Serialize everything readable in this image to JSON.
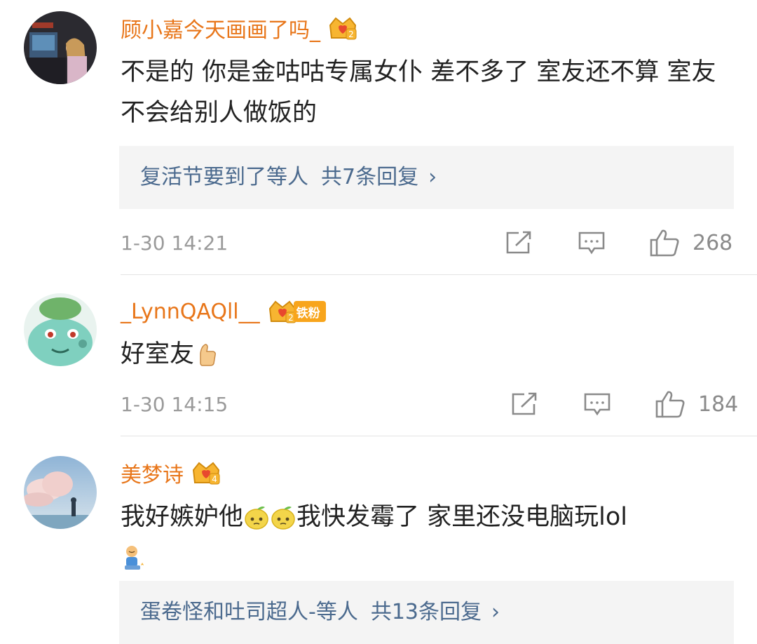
{
  "comments": [
    {
      "username": "顾小嘉今天画画了吗_",
      "badge_level": "2",
      "text": "不是的 你是金咕咕专属女仆 差不多了 室友还不算 室友不会给别人做饭的",
      "reply_preview": "复活节要到了等人",
      "reply_count": "共7条回复",
      "time": "1-30 14:21",
      "likes": "268"
    },
    {
      "username": "_LynnQAQll__",
      "badge_level": "2",
      "fan_tag": "铁粉",
      "text": "好室友",
      "time": "1-30 14:15",
      "likes": "184"
    },
    {
      "username": "美梦诗",
      "badge_level": "4",
      "text_part1": "我好嫉妒他",
      "text_part2": "我快发霉了 家里还没电脑玩lol",
      "reply_preview": "蛋卷怪和吐司超人-等人",
      "reply_count": "共13条回复"
    }
  ],
  "icons": {
    "share": "share-icon",
    "comment": "comment-icon",
    "like": "thumbs-up-icon",
    "chevron": "chevron-right-icon"
  },
  "colors": {
    "username": "#e8761a",
    "reply_link": "#4b6a8e",
    "meta": "#9a9a9a",
    "reply_bg": "#f4f4f4"
  }
}
